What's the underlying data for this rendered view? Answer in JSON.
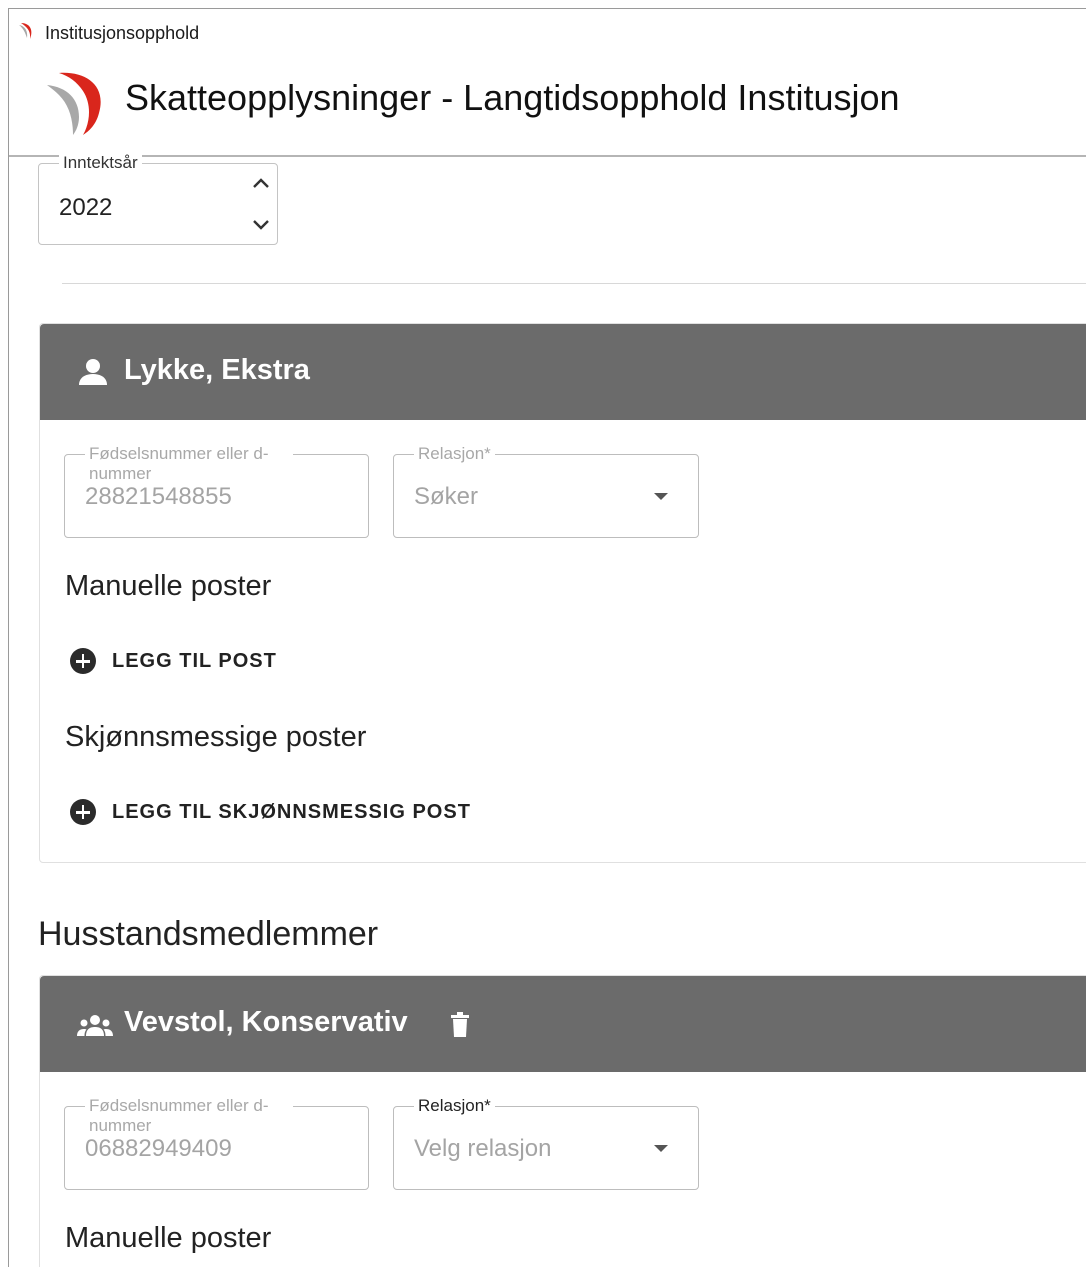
{
  "window": {
    "title": "Institusjonsopphold",
    "app_title": "Skatteopplysninger - Langtidsopphold Institusjon"
  },
  "income_year": {
    "label": "Inntektsår",
    "value": "2022"
  },
  "applicant": {
    "name": "Lykke, Ekstra",
    "id_label": "Fødselsnummer eller d-nummer",
    "id_value": "28821548855",
    "relation_label": "Relasjon*",
    "relation_value": "Søker",
    "manual_title": "Manuelle poster",
    "add_manual": "LEGG TIL POST",
    "discretionary_title": "Skjønnsmessige poster",
    "add_discretionary": "LEGG TIL SKJØNNSMESSIG POST"
  },
  "household": {
    "title": "Husstandsmedlemmer",
    "members": [
      {
        "name": "Vevstol, Konservativ",
        "id_label": "Fødselsnummer eller d-nummer",
        "id_value": "06882949409",
        "relation_label": "Relasjon*",
        "relation_placeholder": "Velg relasjon",
        "manual_title": "Manuelle poster"
      }
    ]
  },
  "colors": {
    "card_header": "#6b6b6b",
    "logo_red": "#d9261c",
    "logo_gray": "#a8a8a8"
  }
}
